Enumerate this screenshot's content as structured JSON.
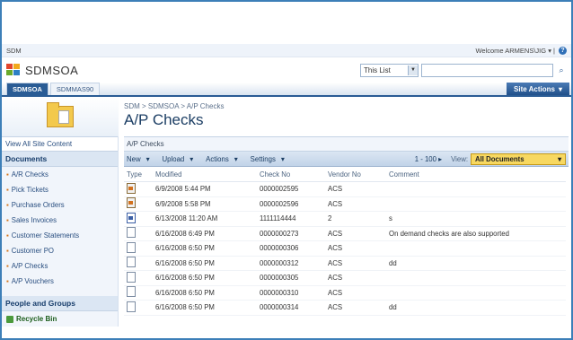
{
  "topbar": {
    "site": "SDM",
    "welcome": "Welcome ARMENS\\JIG",
    "help_icon": "help-icon"
  },
  "header": {
    "site_title": "SDMSOA",
    "search_scope": "This List"
  },
  "tabs": [
    "SDMSOA",
    "SDMMAS90"
  ],
  "site_actions": "Site Actions",
  "left": {
    "view_all": "View All Site Content",
    "documents_heading": "Documents",
    "documents": [
      "A/R Checks",
      "Pick Tickets",
      "Purchase Orders",
      "Sales Invoices",
      "Customer Statements",
      "Customer PO",
      "A/P Checks",
      "A/P Vouchers"
    ],
    "people_heading": "People and Groups",
    "recycle": "Recycle Bin"
  },
  "main": {
    "breadcrumb": "SDM > SDMSOA > A/P Checks",
    "title": "A/P Checks",
    "list_caption": "A/P Checks",
    "toolbar": {
      "new": "New",
      "upload": "Upload",
      "actions": "Actions",
      "settings": "Settings",
      "paging": "1 - 100",
      "view_label": "View:",
      "view_value": "All Documents"
    },
    "columns": [
      "Type",
      "Modified",
      "Check No",
      "Vendor No",
      "Comment"
    ],
    "rows": [
      {
        "type": "excel",
        "modified": "6/9/2008 5:44 PM",
        "check": "0000002595",
        "vendor": "ACS",
        "comment": ""
      },
      {
        "type": "excel",
        "modified": "6/9/2008 5:58 PM",
        "check": "0000002596",
        "vendor": "ACS",
        "comment": ""
      },
      {
        "type": "word",
        "modified": "6/13/2008 11:20 AM",
        "check": "1111114444",
        "vendor": "2",
        "comment": "s"
      },
      {
        "type": "doc",
        "modified": "6/16/2008 6:49 PM",
        "check": "0000000273",
        "vendor": "ACS",
        "comment": "On demand checks are also supported"
      },
      {
        "type": "doc",
        "modified": "6/16/2008 6:50 PM",
        "check": "0000000306",
        "vendor": "ACS",
        "comment": ""
      },
      {
        "type": "doc",
        "modified": "6/16/2008 6:50 PM",
        "check": "0000000312",
        "vendor": "ACS",
        "comment": "dd"
      },
      {
        "type": "doc",
        "modified": "6/16/2008 6:50 PM",
        "check": "0000000305",
        "vendor": "ACS",
        "comment": ""
      },
      {
        "type": "doc",
        "modified": "6/16/2008 6:50 PM",
        "check": "0000000310",
        "vendor": "ACS",
        "comment": ""
      },
      {
        "type": "doc",
        "modified": "6/16/2008 6:50 PM",
        "check": "0000000314",
        "vendor": "ACS",
        "comment": "dd"
      }
    ]
  }
}
